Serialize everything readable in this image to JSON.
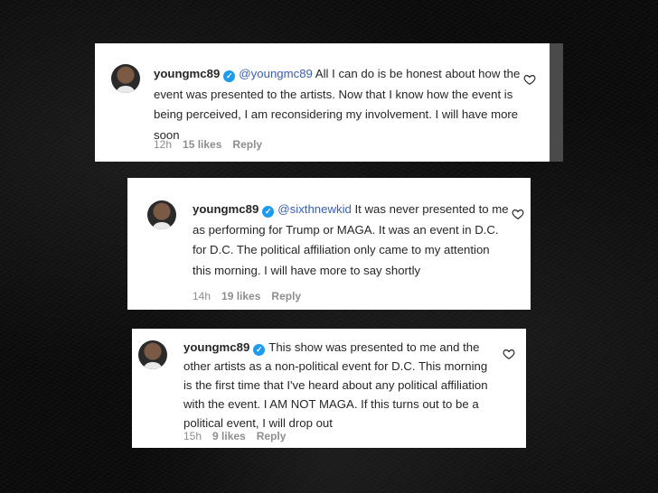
{
  "comments": [
    {
      "username": "youngmc89",
      "mention": "@youngmc89",
      "body": " All I can do is be honest about how the event was presented to the artists. Now that I know how the event is being perceived, I am reconsidering my involvement. I will have more soon",
      "time": "12h",
      "likes": "15 likes",
      "reply": "Reply"
    },
    {
      "username": "youngmc89",
      "mention": "@sixthnewkid",
      "body": " It was never presented to me as performing for Trump or MAGA. It was an event in D.C. for D.C. The political affiliation only came to my attention this morning. I will have more to say shortly",
      "time": "14h",
      "likes": "19 likes",
      "reply": "Reply"
    },
    {
      "username": "youngmc89",
      "mention": "",
      "body": "This show was presented to me and the other artists as a non-political event for D.C. This morning is the first time that I've heard about any political affiliation with the event. I AM NOT MAGA. If this turns out to be a political event, I will drop out",
      "time": "15h",
      "likes": "9 likes",
      "reply": "Reply"
    }
  ],
  "verified_mark": "✓",
  "colors": {
    "background": "#0b0b0b",
    "card": "#ffffff",
    "text": "#262626",
    "mention": "#3a5fb0",
    "verified": "#1d9bf0",
    "meta": "#8e8e8e"
  },
  "icons": [
    "verified-badge-icon",
    "heart-icon",
    "avatar"
  ]
}
